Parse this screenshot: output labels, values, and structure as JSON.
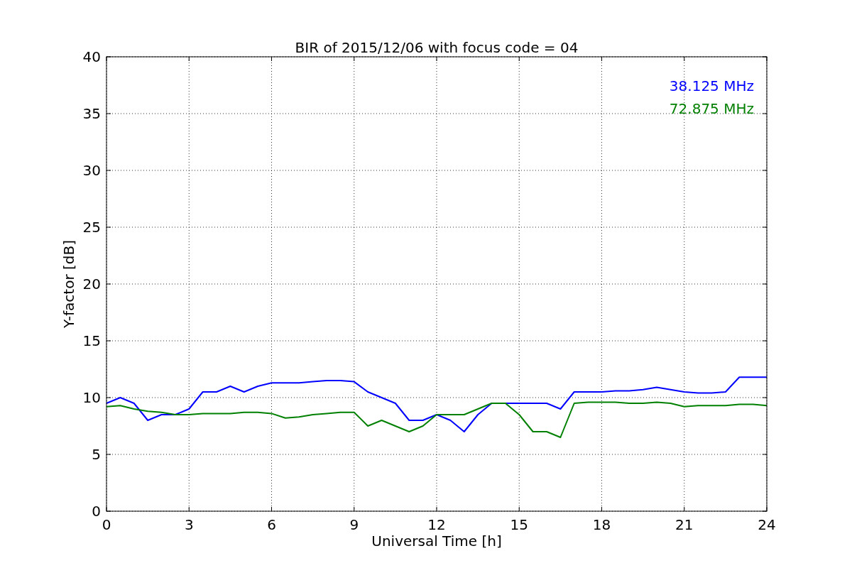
{
  "chart_data": {
    "type": "line",
    "title": "BIR of 2015/12/06 with focus code = 04",
    "xlabel": "Universal Time [h]",
    "ylabel": "Y-factor [dB]",
    "x": [
      0,
      0.5,
      1,
      1.5,
      2,
      2.5,
      3,
      3.5,
      4,
      4.5,
      5,
      5.5,
      6,
      6.5,
      7,
      7.5,
      8,
      8.5,
      9,
      9.5,
      10,
      10.5,
      11,
      11.5,
      12,
      12.5,
      13,
      13.5,
      14,
      14.5,
      15,
      15.5,
      16,
      16.5,
      17,
      17.5,
      18,
      18.5,
      19,
      19.5,
      20,
      20.5,
      21,
      21.5,
      22,
      22.5,
      23,
      23.5,
      24
    ],
    "series": [
      {
        "name": "38.125 MHz",
        "color": "#0000ff",
        "values": [
          9.5,
          10,
          9.5,
          8,
          8.5,
          8.5,
          9,
          10.5,
          10.5,
          11,
          10.5,
          11,
          11.3,
          11.3,
          11.3,
          11.4,
          11.5,
          11.5,
          11.4,
          10.5,
          10,
          9.5,
          8,
          8,
          8.5,
          8,
          7,
          8.5,
          9.5,
          9.5,
          9.5,
          9.5,
          9.5,
          9,
          10.5,
          10.5,
          10.5,
          10.6,
          10.6,
          10.7,
          10.9,
          10.7,
          10.5,
          10.4,
          10.4,
          10.5,
          11.8,
          11.8,
          11.8
        ]
      },
      {
        "name": "72.875 MHz",
        "color": "#008000",
        "values": [
          9.2,
          9.3,
          9,
          8.8,
          8.7,
          8.5,
          8.5,
          8.6,
          8.6,
          8.6,
          8.7,
          8.7,
          8.6,
          8.2,
          8.3,
          8.5,
          8.6,
          8.7,
          8.7,
          7.5,
          8,
          7.5,
          7,
          7.5,
          8.5,
          8.5,
          8.5,
          9,
          9.5,
          9.5,
          8.5,
          7,
          7,
          6.5,
          9.5,
          9.6,
          9.6,
          9.6,
          9.5,
          9.5,
          9.6,
          9.5,
          9.2,
          9.3,
          9.3,
          9.3,
          9.4,
          9.4,
          9.3
        ]
      }
    ],
    "xlim": [
      0,
      24
    ],
    "ylim": [
      0,
      40
    ],
    "xticks": [
      0,
      3,
      6,
      9,
      12,
      15,
      18,
      21,
      24
    ],
    "yticks": [
      0,
      5,
      10,
      15,
      20,
      25,
      30,
      35,
      40
    ],
    "grid": true
  }
}
